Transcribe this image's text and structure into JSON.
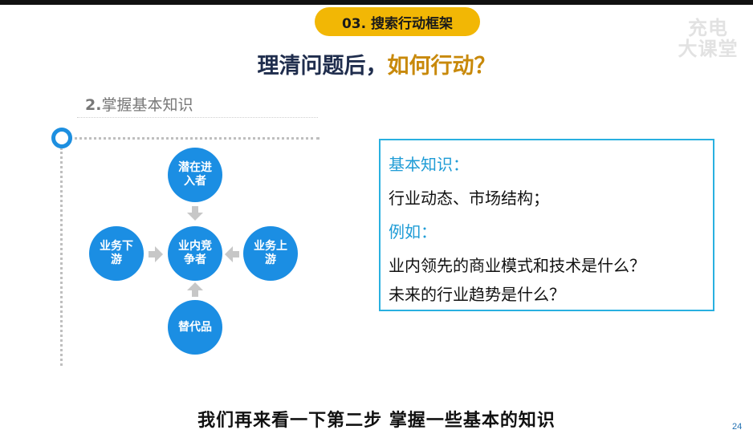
{
  "header": {
    "section_label": "03. 搜索行动框架",
    "watermark_line1": "充电",
    "watermark_line2": "大课堂"
  },
  "title": {
    "part1": "理清问题后，",
    "part2": "如何行动？",
    "highlight_color": "#c8890a"
  },
  "subtitle": {
    "number": "2.",
    "text": "掌握基本知识"
  },
  "diagram": {
    "top_node": "潜在进入者",
    "center_node": "业内竞争者",
    "left_node": "业务下游",
    "right_node": "业务上游",
    "bottom_node": "替代品",
    "node_color": "#1b8ee3"
  },
  "info_box": {
    "line1": "基本知识：",
    "line2": "行业动态、市场结构；",
    "line3": "例如：",
    "line4": "业内领先的商业模式和技术是什么？",
    "line5": "未来的行业趋势是什么？",
    "border_color": "#29b0e0"
  },
  "caption": "我们再来看一下第二步 掌握一些基本的知识",
  "page_number": "24"
}
